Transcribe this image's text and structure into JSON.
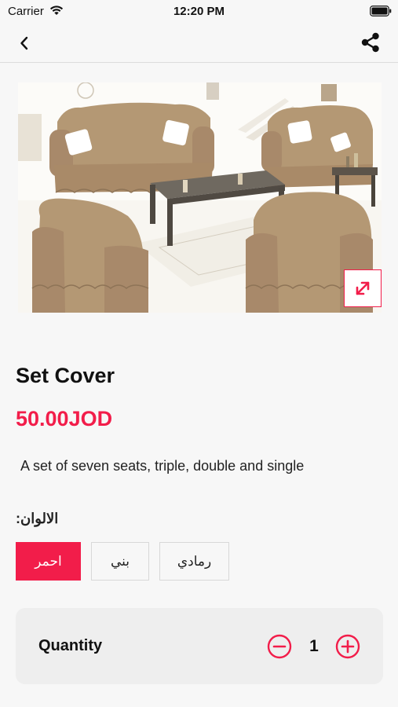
{
  "status_bar": {
    "carrier": "Carrier",
    "time": "12:20 PM"
  },
  "product": {
    "title": "Set Cover",
    "price": "50.00JOD",
    "description": "A set of seven seats, triple, double and single"
  },
  "colors": {
    "label": "الالوان:",
    "options": [
      "احمر",
      "بني",
      "رمادي"
    ],
    "selected_index": 0
  },
  "quantity": {
    "label": "Quantity",
    "value": "1"
  },
  "theme": {
    "accent": "#f21d4a",
    "sofa": "#b49874"
  },
  "icons": {
    "back": "chevron-left-icon",
    "share": "share-icon",
    "expand": "expand-arrows-icon",
    "minus": "minus-circle-icon",
    "plus": "plus-circle-icon"
  }
}
